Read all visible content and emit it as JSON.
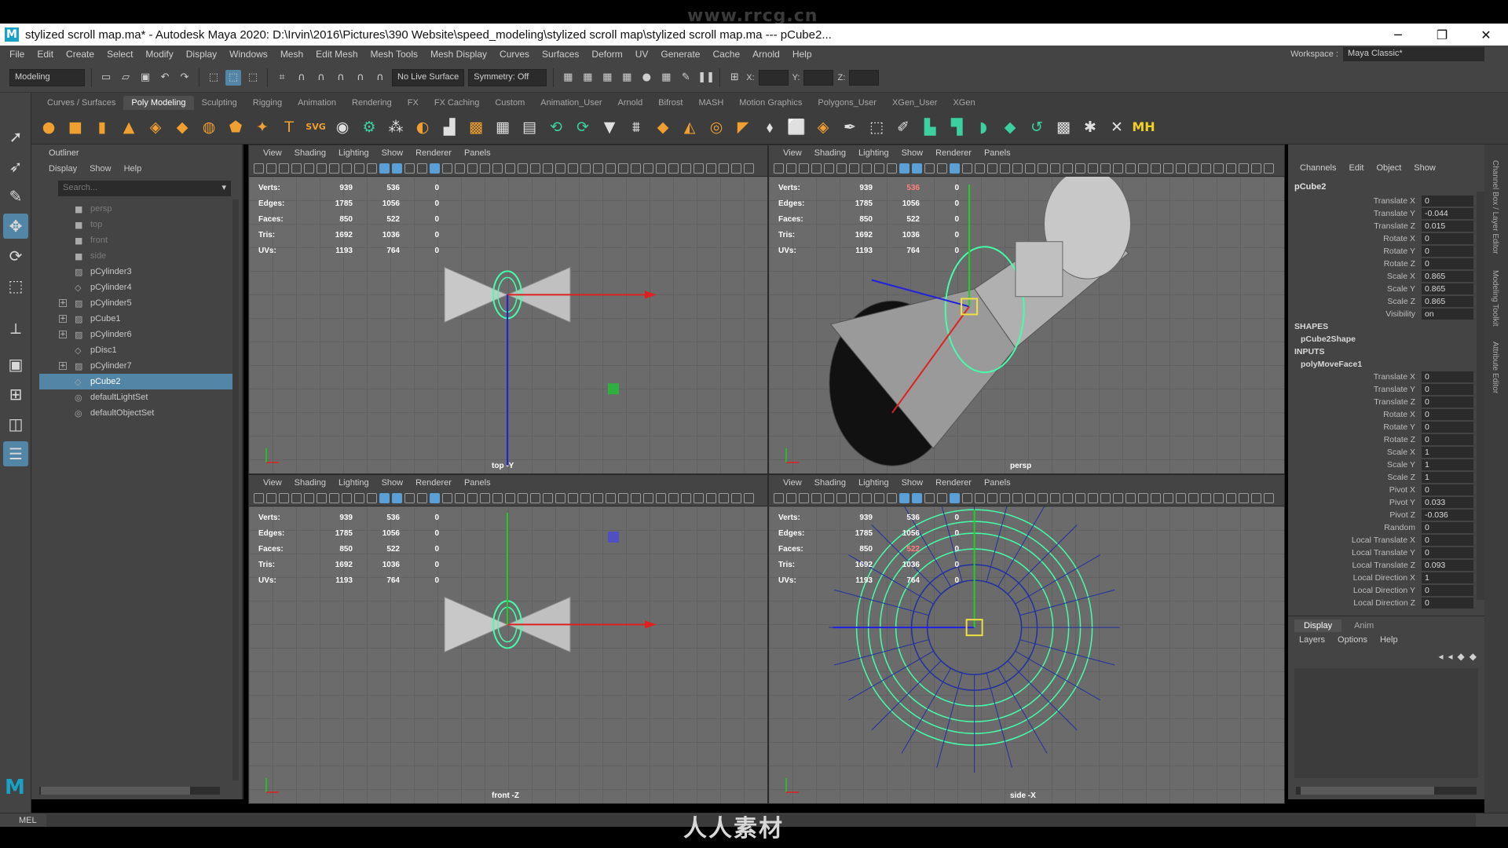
{
  "watermark_top": "www.rrcg.cn",
  "watermark_bottom": "人人素材",
  "title": "stylized scroll map.ma* - Autodesk Maya 2020: D:\\Irvin\\2016\\Pictures\\390 Website\\speed_modeling\\stylized scroll map\\stylized scroll map.ma   ---   pCube2...",
  "window_controls": {
    "minimize": "─",
    "restore": "❐",
    "close": "✕"
  },
  "menus": [
    "File",
    "Edit",
    "Create",
    "Select",
    "Modify",
    "Display",
    "Windows",
    "Mesh",
    "Edit Mesh",
    "Mesh Tools",
    "Mesh Display",
    "Curves",
    "Surfaces",
    "Deform",
    "UV",
    "Generate",
    "Cache",
    "Arnold",
    "Help"
  ],
  "workspace": {
    "label": "Workspace :",
    "value": "Maya Classic*"
  },
  "status": {
    "menu_set": "Modeling",
    "live_surface": "No Live Surface",
    "symmetry": "Symmetry: Off",
    "x_label": "X:",
    "y_label": "Y:",
    "z_label": "Z:"
  },
  "shelf_tabs": [
    "Curves / Surfaces",
    "Poly Modeling",
    "Sculpting",
    "Rigging",
    "Animation",
    "Rendering",
    "FX",
    "FX Caching",
    "Custom",
    "Animation_User",
    "Arnold",
    "Bifrost",
    "MASH",
    "Motion Graphics",
    "Polygons_User",
    "XGen_User",
    "XGen"
  ],
  "shelf_active": "Poly Modeling",
  "shelf_svg_label": "SVG",
  "shelf_t_label": "T",
  "shelf_mh_label": "MH",
  "outliner": {
    "title": "Outliner",
    "menu": [
      "Display",
      "Show",
      "Help"
    ],
    "search_placeholder": "Search...",
    "items": [
      {
        "label": "persp",
        "kind": "camera",
        "dim": true
      },
      {
        "label": "top",
        "kind": "camera",
        "dim": true
      },
      {
        "label": "front",
        "kind": "camera",
        "dim": true
      },
      {
        "label": "side",
        "kind": "camera",
        "dim": true
      },
      {
        "label": "pCylinder3",
        "kind": "mesh"
      },
      {
        "label": "pCylinder4",
        "kind": "group"
      },
      {
        "label": "pCylinder5",
        "kind": "mesh",
        "expand": true
      },
      {
        "label": "pCube1",
        "kind": "mesh",
        "expand": true
      },
      {
        "label": "pCylinder6",
        "kind": "mesh",
        "expand": true
      },
      {
        "label": "pDisc1",
        "kind": "group"
      },
      {
        "label": "pCylinder7",
        "kind": "mesh",
        "expand": true
      },
      {
        "label": "pCube2",
        "kind": "group",
        "selected": true
      },
      {
        "label": "defaultLightSet",
        "kind": "set"
      },
      {
        "label": "defaultObjectSet",
        "kind": "set"
      }
    ]
  },
  "viewport_menu": [
    "View",
    "Shading",
    "Lighting",
    "Show",
    "Renderer",
    "Panels"
  ],
  "hud": {
    "labels": [
      "Verts:",
      "Edges:",
      "Faces:",
      "Tris:",
      "UVs:"
    ],
    "col1": [
      "939",
      "1785",
      "850",
      "1692",
      "1193"
    ],
    "col2": [
      "536",
      "1056",
      "522",
      "1036",
      "764"
    ],
    "col3": [
      "0",
      "0",
      "0",
      "0",
      "0"
    ]
  },
  "cameras": {
    "top_left": "top -Y",
    "top_right": "persp",
    "bottom_left": "front -Z",
    "bottom_right": "side -X"
  },
  "channel_box": {
    "menu": [
      "Channels",
      "Edit",
      "Object",
      "Show"
    ],
    "object": "pCube2",
    "transform": [
      {
        "label": "Translate X",
        "value": "0"
      },
      {
        "label": "Translate Y",
        "value": "-0.044"
      },
      {
        "label": "Translate Z",
        "value": "0.015"
      },
      {
        "label": "Rotate X",
        "value": "0"
      },
      {
        "label": "Rotate Y",
        "value": "0"
      },
      {
        "label": "Rotate Z",
        "value": "0"
      },
      {
        "label": "Scale X",
        "value": "0.865"
      },
      {
        "label": "Scale Y",
        "value": "0.865"
      },
      {
        "label": "Scale Z",
        "value": "0.865"
      },
      {
        "label": "Visibility",
        "value": "on"
      }
    ],
    "shapes_header": "SHAPES",
    "shape": "pCube2Shape",
    "inputs_header": "INPUTS",
    "input": "polyMoveFace1",
    "input_channels": [
      {
        "label": "Translate X",
        "value": "0"
      },
      {
        "label": "Translate Y",
        "value": "0"
      },
      {
        "label": "Translate Z",
        "value": "0"
      },
      {
        "label": "Rotate X",
        "value": "0"
      },
      {
        "label": "Rotate Y",
        "value": "0"
      },
      {
        "label": "Rotate Z",
        "value": "0"
      },
      {
        "label": "Scale X",
        "value": "1"
      },
      {
        "label": "Scale Y",
        "value": "1"
      },
      {
        "label": "Scale Z",
        "value": "1"
      },
      {
        "label": "Pivot X",
        "value": "0"
      },
      {
        "label": "Pivot Y",
        "value": "0.033"
      },
      {
        "label": "Pivot Z",
        "value": "-0.036"
      },
      {
        "label": "Random",
        "value": "0"
      },
      {
        "label": "Local Translate X",
        "value": "0"
      },
      {
        "label": "Local Translate Y",
        "value": "0"
      },
      {
        "label": "Local Translate Z",
        "value": "0.093"
      },
      {
        "label": "Local Direction X",
        "value": "1"
      },
      {
        "label": "Local Direction Y",
        "value": "0"
      },
      {
        "label": "Local Direction Z",
        "value": "0"
      }
    ]
  },
  "side_tabs": [
    "Channel Box / Layer Editor",
    "Modeling Toolkit",
    "Attribute Editor"
  ],
  "layer_editor": {
    "tabs": [
      "Display",
      "Anim"
    ],
    "menu": [
      "Layers",
      "Options",
      "Help"
    ]
  },
  "command_line": {
    "label": "MEL"
  },
  "colors": {
    "selection": "#5285a6",
    "wire_green": "#44ffaa",
    "axis_red": "#e02020",
    "axis_blue": "#2020e0",
    "axis_green": "#20d020"
  }
}
